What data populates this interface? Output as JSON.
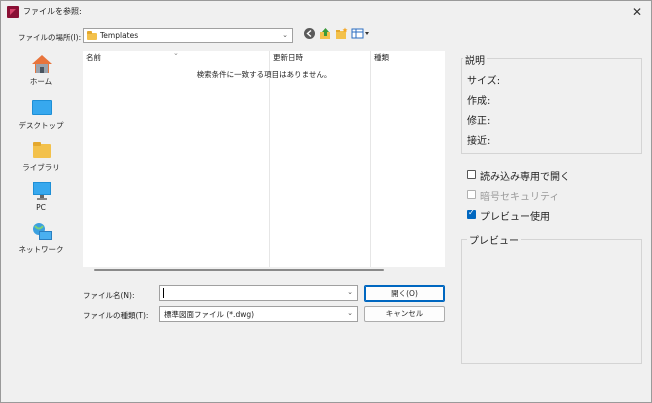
{
  "window": {
    "title": "ファイルを参照:"
  },
  "location": {
    "label": "ファイルの場所(I):",
    "value": "Templates"
  },
  "toolbar": {
    "icons": [
      "back-icon",
      "up-folder-icon",
      "new-folder-icon",
      "view-menu-icon"
    ]
  },
  "places": [
    {
      "label": "ホーム",
      "icon": "home-icon"
    },
    {
      "label": "デスクトップ",
      "icon": "desktop-icon"
    },
    {
      "label": "ライブラリ",
      "icon": "library-icon"
    },
    {
      "label": "PC",
      "icon": "pc-icon"
    },
    {
      "label": "ネットワーク",
      "icon": "network-icon"
    }
  ],
  "filelist": {
    "columns": [
      "名前",
      "更新日時",
      "種類"
    ],
    "empty_message": "検索条件に一致する項目はありません。"
  },
  "filename": {
    "label": "ファイル名(N):",
    "value": ""
  },
  "filetype": {
    "label": "ファイルの種類(T):",
    "value": "標準図面ファイル (*.dwg)"
  },
  "buttons": {
    "open": "開く(O)",
    "cancel": "キャンセル"
  },
  "description": {
    "title": "説明",
    "fields": [
      "サイズ:",
      "作成:",
      "修正:",
      "接近:"
    ]
  },
  "options": [
    {
      "label": "読み込み専用で開く",
      "checked": false,
      "disabled": false
    },
    {
      "label": "暗号セキュリティ",
      "checked": false,
      "disabled": true
    },
    {
      "label": "プレビュー使用",
      "checked": true,
      "disabled": false
    }
  ],
  "preview": {
    "title": "プレビュー"
  },
  "colors": {
    "accent": "#0067c0",
    "folder": "#f3c14b"
  }
}
